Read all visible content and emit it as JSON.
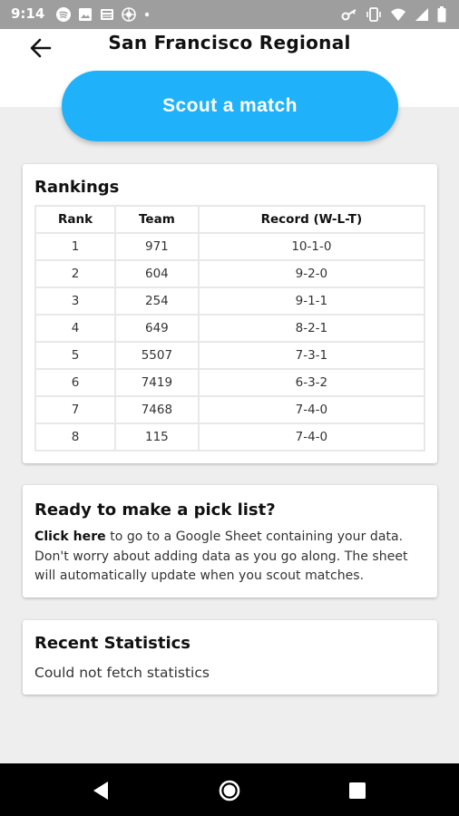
{
  "status_bar": {
    "time": "9:14",
    "notification_icons": [
      "spotify-icon",
      "image-icon",
      "news-icon",
      "pinwheel-icon",
      "dot-icon"
    ],
    "system_icons": [
      "key-icon",
      "vibrate-icon",
      "wifi-icon",
      "signal-icon",
      "battery-icon"
    ]
  },
  "app_bar": {
    "back_icon": "arrow-left-icon",
    "title": "San Francisco Regional"
  },
  "scout_button": {
    "label": "Scout a match",
    "color": "#1fb2fa"
  },
  "rankings": {
    "title": "Rankings",
    "columns": [
      "Rank",
      "Team",
      "Record (W-L-T)"
    ],
    "rows": [
      [
        "1",
        "971",
        "10-1-0"
      ],
      [
        "2",
        "604",
        "9-2-0"
      ],
      [
        "3",
        "254",
        "9-1-1"
      ],
      [
        "4",
        "649",
        "8-2-1"
      ],
      [
        "5",
        "5507",
        "7-3-1"
      ],
      [
        "6",
        "7419",
        "6-3-2"
      ],
      [
        "7",
        "7468",
        "7-4-0"
      ],
      [
        "8",
        "115",
        "7-4-0"
      ]
    ]
  },
  "pick_list": {
    "title": "Ready to make a pick list?",
    "link_text": "Click here",
    "body_text": " to go to a Google Sheet containing your data. Don't worry about adding data as you go along. The sheet will automatically update when you scout matches."
  },
  "recent_statistics": {
    "title": "Recent Statistics",
    "message": "Could not fetch statistics"
  },
  "nav_bar": {
    "icons": [
      "back-triangle-icon",
      "home-circle-icon",
      "recents-square-icon"
    ]
  }
}
